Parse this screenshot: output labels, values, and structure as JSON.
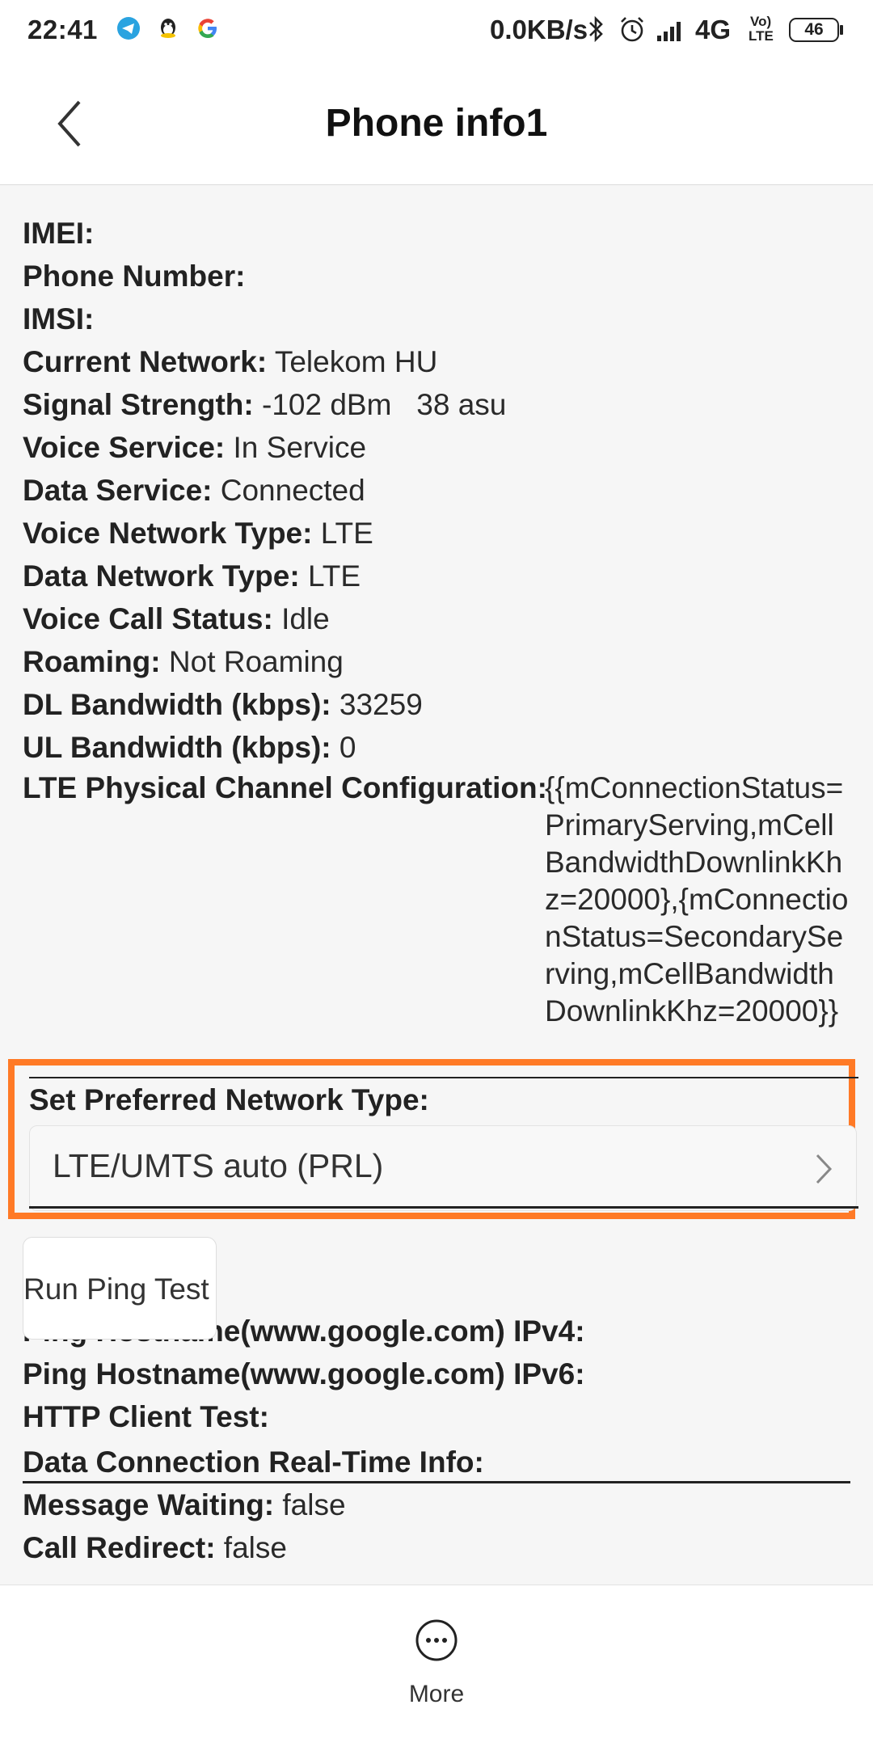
{
  "status_bar": {
    "time": "22:41",
    "speed": "0.0KB/s",
    "network": "4G",
    "volte_top": "Vo)",
    "volte_bottom": "LTE",
    "battery": "46",
    "left_icons": [
      "telegram-icon",
      "qq-icon",
      "google-icon"
    ],
    "right_icons": [
      "bluetooth-icon",
      "alarm-icon",
      "signal-icon",
      "volte-icon",
      "battery-icon"
    ]
  },
  "header": {
    "title": "Phone info1",
    "back_icon": "back-arrow-icon"
  },
  "info": [
    {
      "label": "IMEI:",
      "value": ""
    },
    {
      "label": "Phone Number:",
      "value": ""
    },
    {
      "label": "IMSI:",
      "value": ""
    },
    {
      "label": "Current Network:",
      "value": "Telekom HU"
    },
    {
      "label": "Signal Strength:",
      "value": "-102 dBm   38 asu"
    },
    {
      "label": "Voice Service:",
      "value": "In Service"
    },
    {
      "label": "Data Service:",
      "value": "Connected"
    },
    {
      "label": "Voice Network Type:",
      "value": "LTE"
    },
    {
      "label": "Data Network Type:",
      "value": "LTE"
    },
    {
      "label": "Voice Call Status:",
      "value": "Idle"
    },
    {
      "label": "Roaming:",
      "value": "Not Roaming"
    },
    {
      "label": "DL Bandwidth (kbps):",
      "value": "33259"
    },
    {
      "label": "UL Bandwidth (kbps):",
      "value": "0"
    }
  ],
  "lte_config": {
    "label": "LTE Physical Channel Configuration:",
    "value": "{{mConnectionStatus=PrimaryServing,mCellBandwidthDownlinkKhz=20000},{mConnectionStatus=SecondaryServing,mCellBandwidthDownlinkKhz=20000}}"
  },
  "preferred_network": {
    "label": "Set Preferred Network Type:",
    "value": "LTE/UMTS auto (PRL)",
    "highlight_color": "#ff7a26"
  },
  "ping": {
    "button_label": "Run Ping Test",
    "ipv4_label": "Ping Hostname(www.google.com) IPv4:",
    "ipv6_label": "Ping Hostname(www.google.com) IPv6:",
    "http_label": "HTTP Client Test:"
  },
  "realtime": {
    "label": "Data Connection Real-Time Info:",
    "message_waiting_label": "Message Waiting:",
    "message_waiting_value": "false",
    "call_redirect_label": "Call Redirect:",
    "call_redirect_value": "false"
  },
  "bottom_bar": {
    "more_label": "More",
    "more_icon": "more-dots-icon"
  }
}
